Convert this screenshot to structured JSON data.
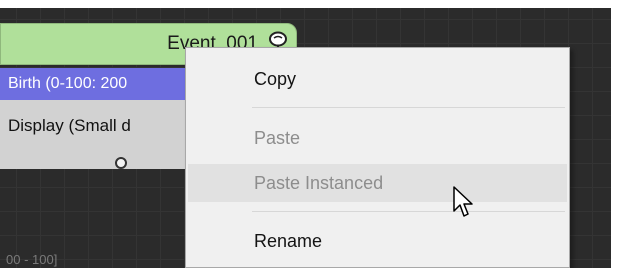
{
  "node": {
    "title": "Event_001",
    "icon": "tree-icon",
    "birth_row": "Birth (0-100: 200",
    "display_row": "Display (Small d",
    "header_color": "#b0e09a",
    "birth_color": "#6e6ee0",
    "display_color": "#d2d2d2"
  },
  "background_label": "00 - 100]",
  "context_menu": {
    "items": [
      {
        "label": "Copy",
        "enabled": true
      },
      {
        "label": "Paste",
        "enabled": false
      },
      {
        "label": "Paste Instanced",
        "enabled": false,
        "hovered": true
      },
      {
        "label": "Rename",
        "enabled": true
      }
    ]
  },
  "cursor": "arrow-cursor-icon"
}
